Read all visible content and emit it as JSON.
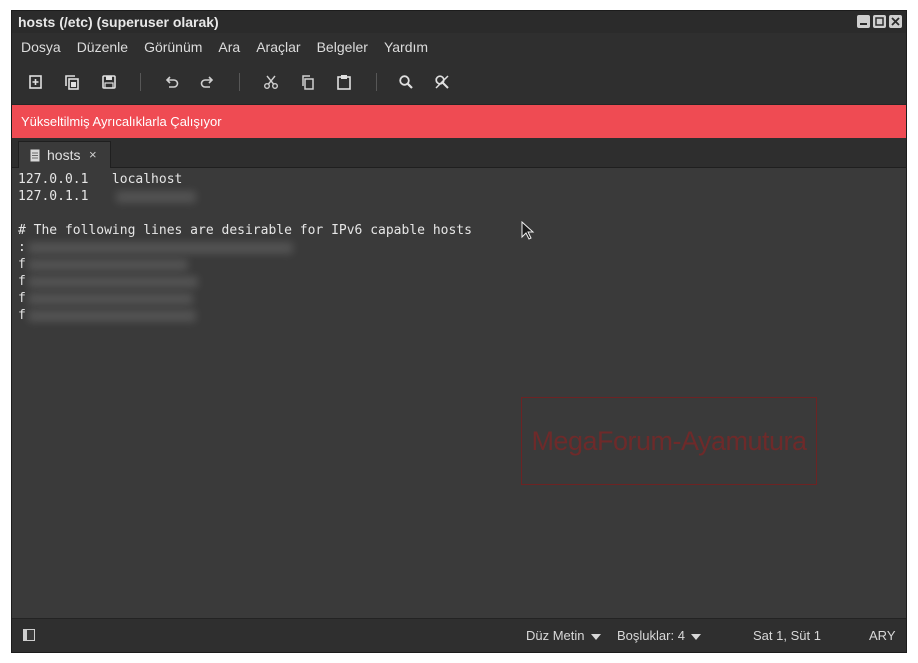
{
  "window": {
    "title": "hosts (/etc) (superuser olarak)"
  },
  "menu": [
    "Dosya",
    "Düzenle",
    "Görünüm",
    "Ara",
    "Araçlar",
    "Belgeler",
    "Yardım"
  ],
  "toolbar_icons": [
    "new-document-icon",
    "open-document-icon",
    "save-icon",
    "undo-icon",
    "redo-icon",
    "cut-icon",
    "copy-icon",
    "paste-icon",
    "search-icon",
    "find-replace-icon"
  ],
  "banner": {
    "text": "Yükseltilmiş Ayrıcalıklarla Çalışıyor"
  },
  "tabs": [
    {
      "label": "hosts",
      "close": "×"
    }
  ],
  "editor": {
    "lines": [
      "127.0.0.1   localhost",
      "127.0.1.1",
      "",
      "# The following lines are desirable for IPv6 capable hosts",
      ":",
      "f",
      "f",
      "f",
      "f"
    ]
  },
  "watermark": {
    "text": "MegaForum-Ayamutura"
  },
  "status": {
    "language": "Düz Metin",
    "spaces": "Boşluklar: 4",
    "position": "Sat 1, Süt 1",
    "mode": "ARY"
  },
  "colors": {
    "banner": "#ef4b53",
    "window": "#3a3a3a",
    "chrome": "#2f2f2f"
  }
}
